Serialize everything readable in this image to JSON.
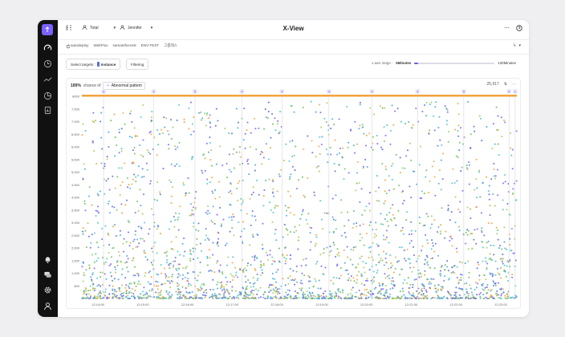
{
  "header": {
    "title": "X-View",
    "group_label": "Total",
    "user_label": "Jennifer"
  },
  "breadcrumb": [
    "autodeploy",
    "WebFlux",
    "samantha-test",
    "ENV-TEST",
    "그룹테스"
  ],
  "toolbar": {
    "select_targets_label": "Select targets :",
    "instance_label": "Instance",
    "filtering_label": "Filtering",
    "x_axis_range_label": "x axis range :",
    "range_min_label": "5Minutes",
    "range_max_label": "120Minutes",
    "range_fraction": 0.02,
    "accent": "#6c5ce7"
  },
  "panel": {
    "percent_label": "100%",
    "chance_label": "chance of",
    "pattern_label": "Abnormal pattern",
    "count_label": "25,917"
  },
  "chart_data": {
    "type": "scatter",
    "ylim": [
      0,
      8000
    ],
    "yticks": [
      500,
      1000,
      1500,
      2000,
      2500,
      3000,
      3500,
      4000,
      4500,
      5000,
      5500,
      6000,
      6500,
      7000,
      7500
    ],
    "ytick_labels": [
      "500",
      "1,000",
      "1,500",
      "2,000",
      "2,500",
      "3,000",
      "3,500",
      "4,000",
      "4,500",
      "5,000",
      "5,500",
      "6,000",
      "6,500",
      "7,000",
      "7,500"
    ],
    "top_label": "8000",
    "xticks": [
      "12:14:59",
      "12:15:00",
      "12:16:00",
      "12:17:00",
      "12:18:00",
      "12:19:00",
      "12:20:00",
      "12:21:00",
      "12:22:00",
      "12:23:00"
    ],
    "markers": [
      {
        "label": "3",
        "x": 0.05
      },
      {
        "label": "4",
        "x": 0.165
      },
      {
        "label": "5",
        "x": 0.26
      },
      {
        "label": "4",
        "x": 0.368
      },
      {
        "label": "4",
        "x": 0.46
      },
      {
        "label": "4",
        "x": 0.568
      },
      {
        "label": "4",
        "x": 0.667
      },
      {
        "label": "4",
        "x": 0.772
      },
      {
        "label": "5",
        "x": 0.878
      },
      {
        "label": "4",
        "x": 0.982
      },
      {
        "label": "1",
        "x": 0.996
      }
    ],
    "point_count": 25917,
    "colors": [
      "#5b6bd6",
      "#4aa3e0",
      "#6bbf59",
      "#a7c957",
      "#f2a33a",
      "#7b61ff",
      "#4fc3c8"
    ]
  }
}
